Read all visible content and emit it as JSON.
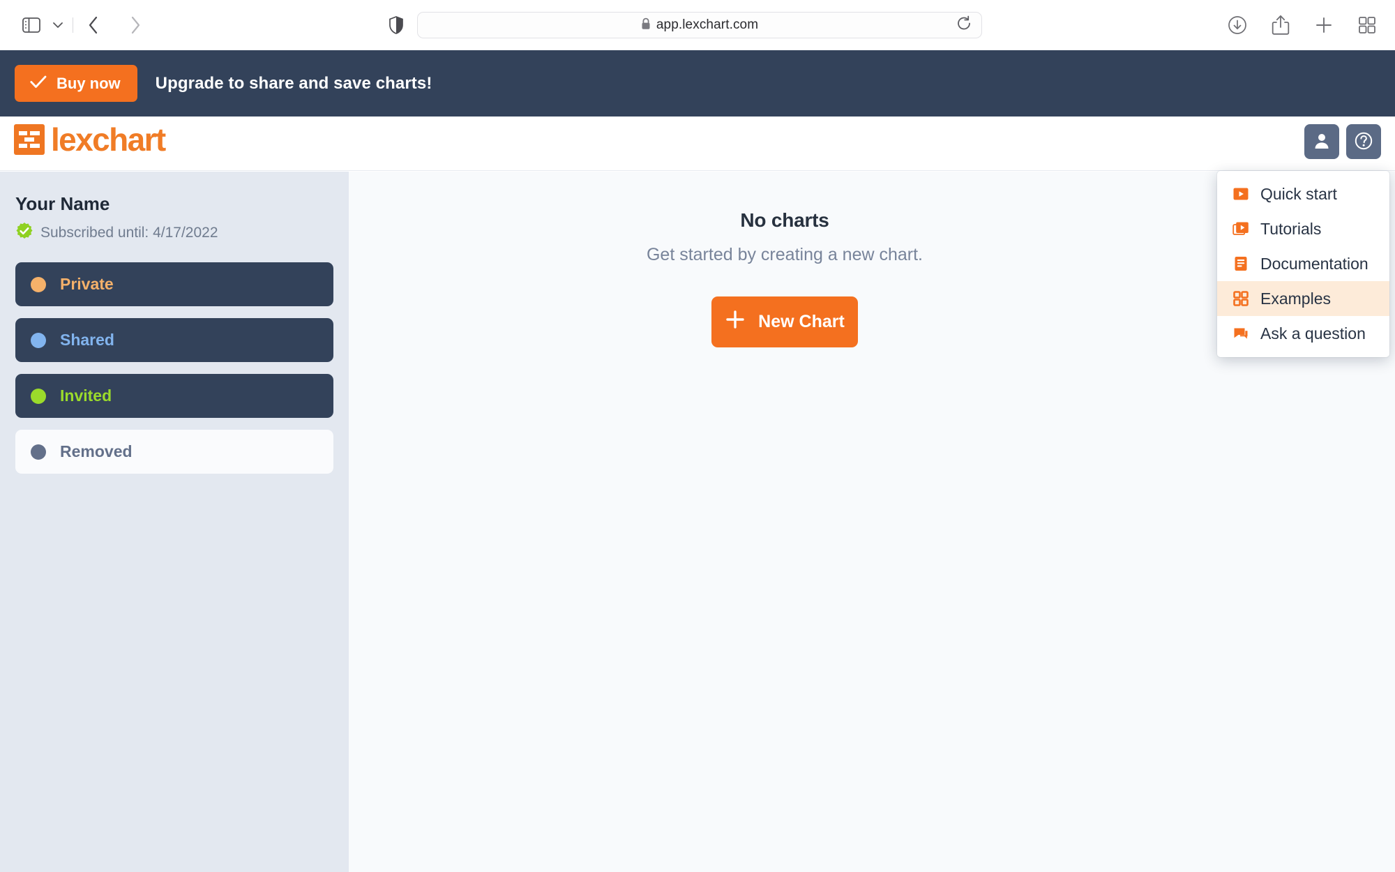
{
  "browser": {
    "url": "app.lexchart.com",
    "lock_icon": "lock-icon",
    "sidebar_toggle_icon": "sidebar-toggle-icon",
    "sidebar_dropdown_icon": "chevron-down-icon",
    "back_icon": "back-chevron-icon",
    "forward_icon": "forward-chevron-icon",
    "shield_icon": "privacy-shield-icon",
    "reload_icon": "reload-icon",
    "downloads_icon": "downloads-icon",
    "share_icon": "share-icon",
    "new_tab_icon": "plus-icon",
    "tab_overview_icon": "tab-overview-icon"
  },
  "promo": {
    "buy_label": "Buy now",
    "check_icon": "check-icon",
    "message": "Upgrade to share and save charts!",
    "bg_color": "#33425a",
    "accent_color": "#f4701f"
  },
  "header": {
    "logo_text": "lexchart",
    "logo_icon": "lexchart-logo-icon",
    "account_icon": "user-icon",
    "help_icon": "question-mark-icon",
    "button_color": "#5b6a85"
  },
  "sidebar": {
    "account_name": "Your Name",
    "subscription_icon": "verified-check-badge-icon",
    "subscription_text": "Subscribed until: 4/17/2022",
    "items": [
      {
        "label": "Private",
        "dot_color": "#f5b16a",
        "text_color": "#f5b16a",
        "style": "dark"
      },
      {
        "label": "Shared",
        "dot_color": "#82b4ee",
        "text_color": "#82b4ee",
        "style": "dark"
      },
      {
        "label": "Invited",
        "dot_color": "#9bdb2b",
        "text_color": "#9bdb2b",
        "style": "dark"
      },
      {
        "label": "Removed",
        "dot_color": "#63708a",
        "text_color": "#63708a",
        "style": "light"
      }
    ]
  },
  "main": {
    "empty_title": "No charts",
    "empty_subtitle": "Get started by creating a new chart.",
    "new_chart_label": "New Chart",
    "new_chart_icon": "plus-icon"
  },
  "help_menu": {
    "items": [
      {
        "label": "Quick start",
        "icon": "play-square-icon",
        "active": false
      },
      {
        "label": "Tutorials",
        "icon": "stacked-play-icon",
        "active": false
      },
      {
        "label": "Documentation",
        "icon": "document-lines-icon",
        "active": false
      },
      {
        "label": "Examples",
        "icon": "grid-squares-icon",
        "active": true
      },
      {
        "label": "Ask a question",
        "icon": "chat-bubbles-icon",
        "active": false
      }
    ],
    "highlight_color": "#fdebd9",
    "icon_color": "#f4701f"
  }
}
